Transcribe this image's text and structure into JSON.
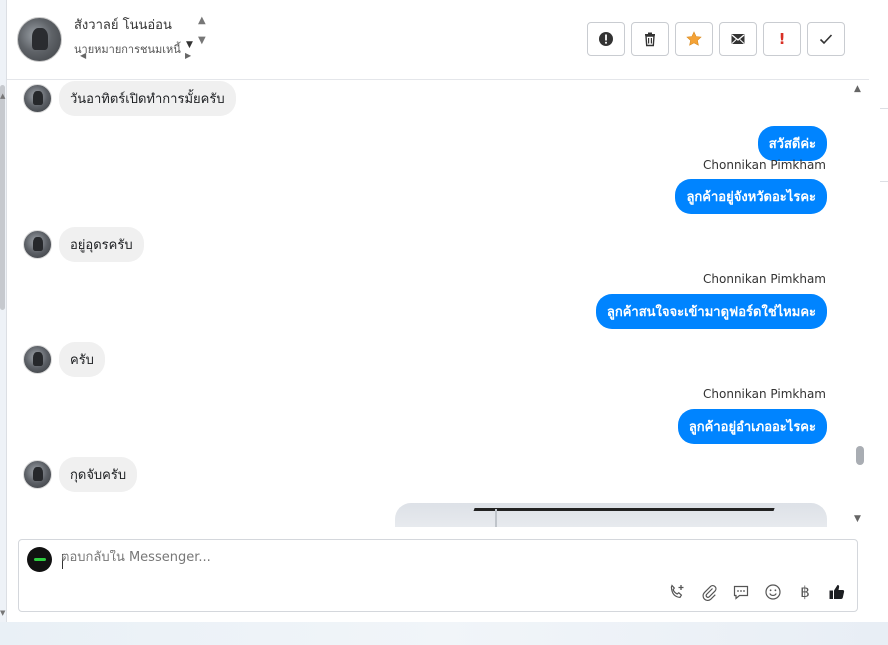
{
  "header": {
    "contact_name": "สังวาลย์ โนนอ่อน",
    "subtitle": "นายหมายการชนมเหนี้"
  },
  "toolbar": {
    "buttons": [
      {
        "name": "report-icon",
        "color": "#333333"
      },
      {
        "name": "trash-icon",
        "color": "#333333"
      },
      {
        "name": "star-icon",
        "color": "#f4a236"
      },
      {
        "name": "mail-icon",
        "color": "#333333"
      },
      {
        "name": "important-icon",
        "label": "!",
        "color": "#d93025"
      },
      {
        "name": "check-icon",
        "color": "#333333"
      }
    ]
  },
  "messages": [
    {
      "dir": "in",
      "text": "วันอาทิตร์เปิดทำการมั้ยครับ"
    },
    {
      "dir": "out",
      "text": "สวัสดีค่ะ"
    },
    {
      "dir": "out",
      "sender": "Chonnikan Pimkham",
      "text": "ลูกค้าอยู่จังหวัดอะไรคะ"
    },
    {
      "dir": "in",
      "text": "อยู่อุดรครับ"
    },
    {
      "dir": "out",
      "sender": "Chonnikan Pimkham",
      "text": "ลูกค้าสนใจจะเข้ามาดูฟอร์ดใช่ไหมคะ"
    },
    {
      "dir": "in",
      "text": "ครับ"
    },
    {
      "dir": "out",
      "sender": "Chonnikan Pimkham",
      "text": "ลูกค้าอยู่อำเภออะไรคะ"
    },
    {
      "dir": "in",
      "text": "กุดจับครับ"
    },
    {
      "dir": "out",
      "type": "image"
    }
  ],
  "composer": {
    "placeholder": "ตอบกลับใน Messenger...",
    "tools": [
      "phone-add-icon",
      "attach-icon",
      "quick-reply-icon",
      "emoji-icon",
      "baht-icon",
      "like-icon"
    ],
    "like_color": "#1c1e21"
  },
  "colors": {
    "outgoing_bubble": "#0084ff",
    "incoming_bubble": "#f0f0f0"
  }
}
